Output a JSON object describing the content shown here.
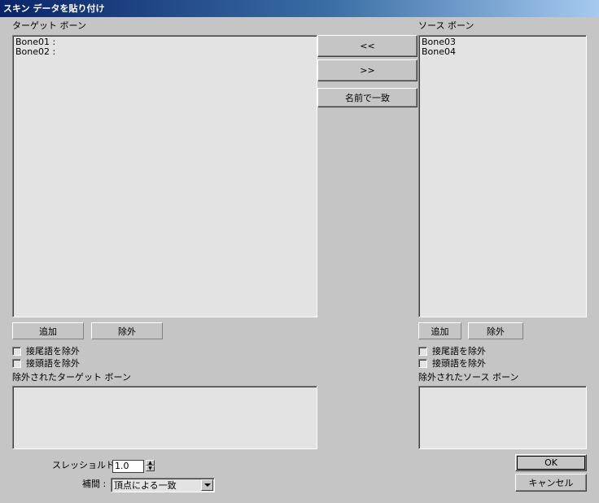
{
  "window": {
    "title": "スキン データを貼り付け"
  },
  "target": {
    "label": "ターゲット ボーン",
    "items": [
      "Bone01 :",
      "Bone02 :"
    ],
    "add_label": "追加",
    "remove_label": "除外",
    "exclude_suffix_label": "接尾語を除外",
    "exclude_prefix_label": "接頭語を除外",
    "excluded_label": "除外されたターゲット ボーン"
  },
  "source": {
    "label": "ソース ボーン",
    "items": [
      "Bone03",
      "Bone04"
    ],
    "add_label": "追加",
    "remove_label": "除外",
    "exclude_suffix_label": "接尾語を除外",
    "exclude_prefix_label": "接頭語を除外",
    "excluded_label": "除外されたソース ボーン"
  },
  "middle": {
    "move_left_label": "<<",
    "move_right_label": ">>",
    "match_by_name_label": "名前で一致"
  },
  "bottom": {
    "threshold_label": "スレッショルド :",
    "threshold_value": "1.0",
    "interp_label": "補間 :",
    "interp_value": "頂点による一致",
    "ok_label": "OK",
    "cancel_label": "キャンセル"
  }
}
